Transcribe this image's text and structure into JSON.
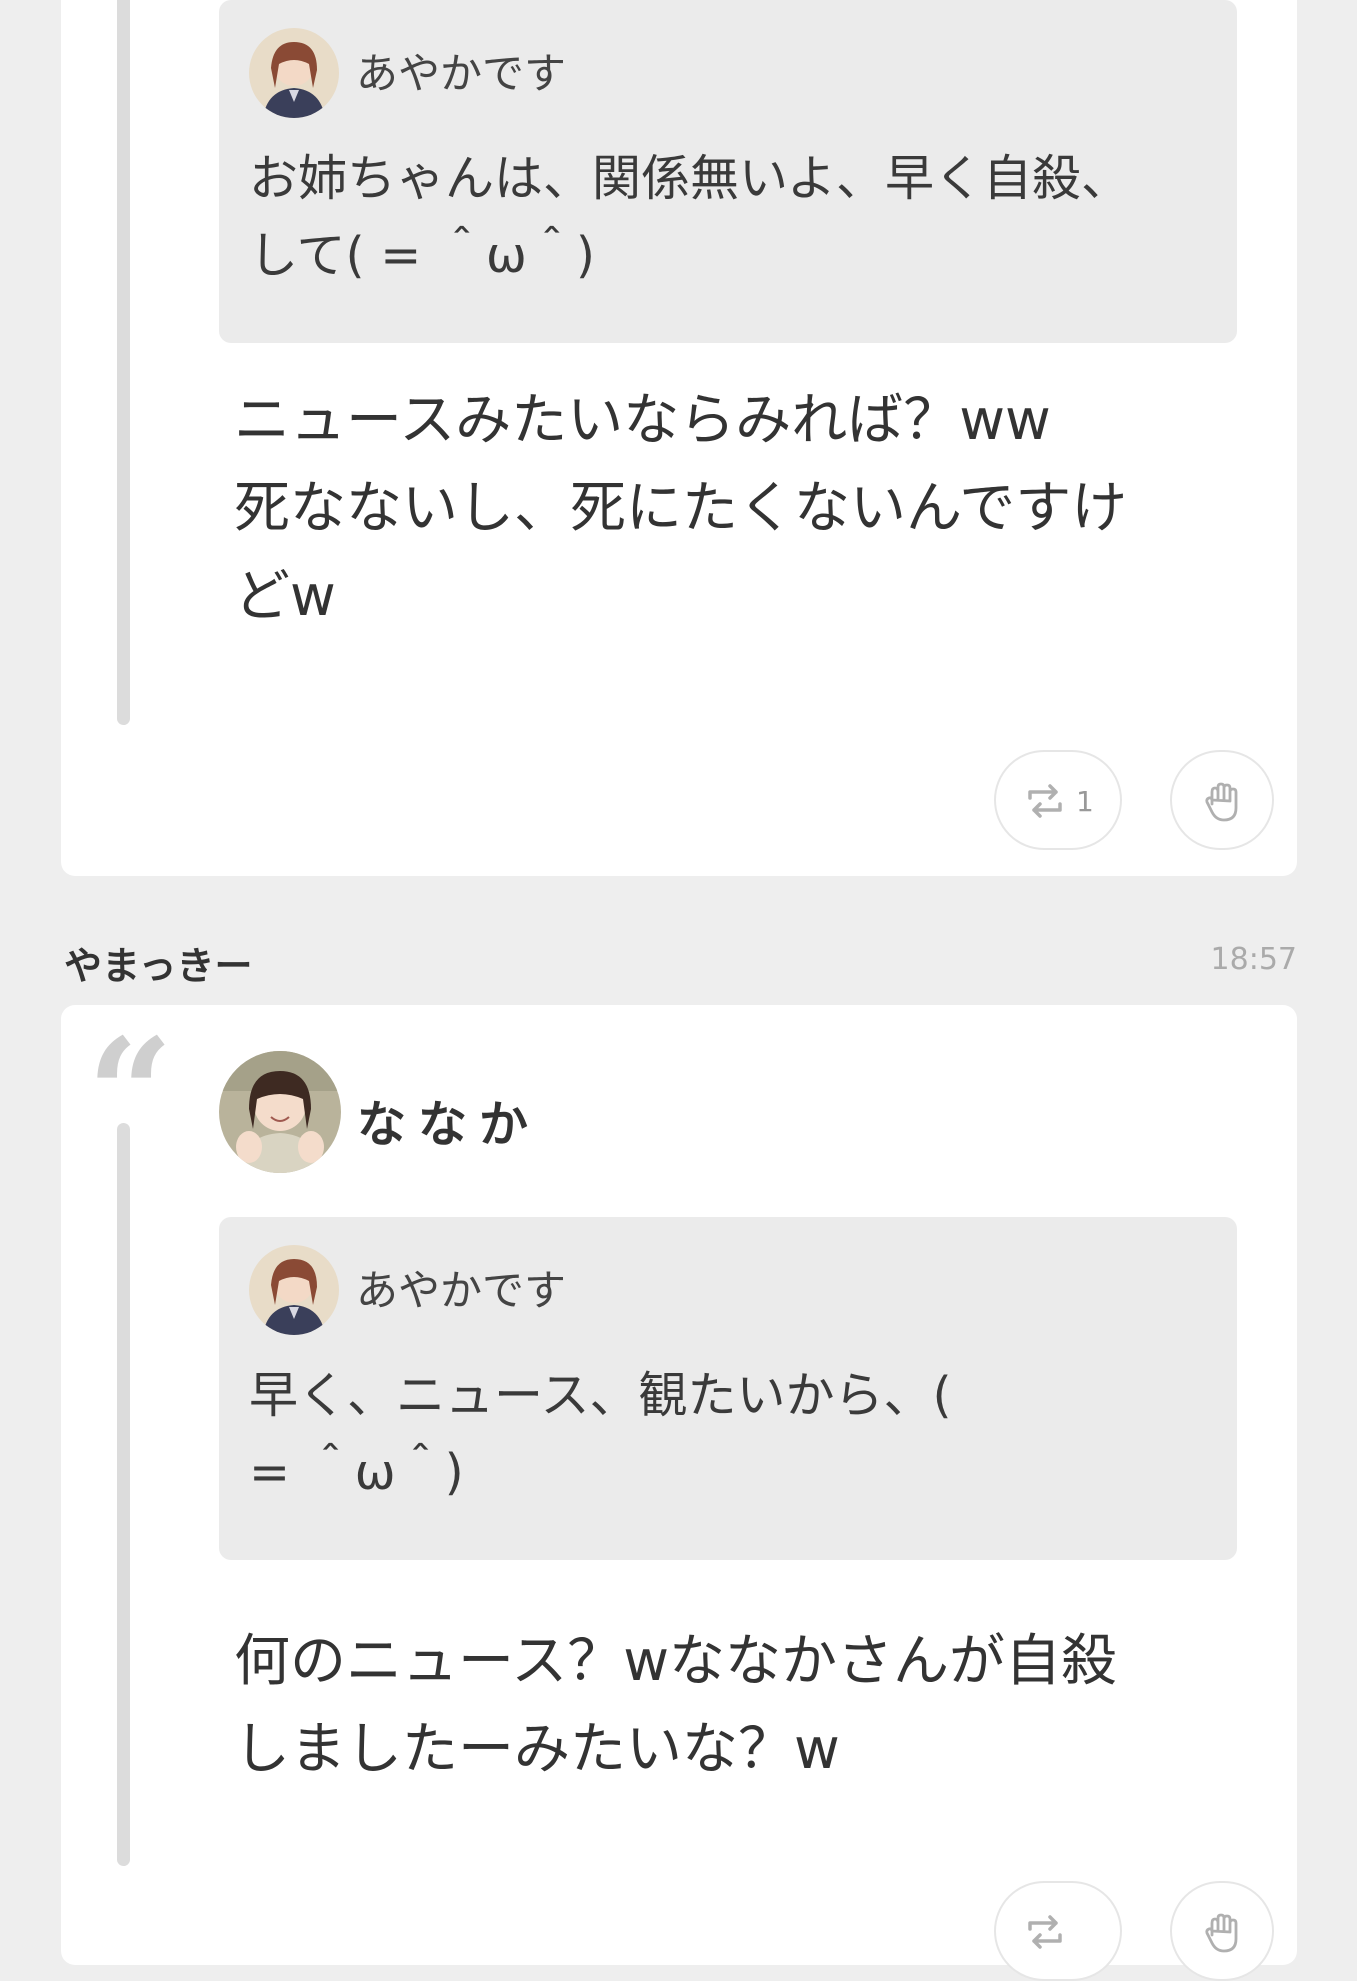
{
  "posts": [
    {
      "quoted": {
        "inner": {
          "name": "あやかです",
          "text": "お姉ちゃんは、関係無いよ、早く自殺、\nして( = ＾ω＾)"
        },
        "text": "ニュースみたいならみれば？ww\n死なないし、死にたくないんですけ\nどw"
      },
      "actions": {
        "repost_count": "1",
        "repost_icon": "repost-icon",
        "clap_icon": "clap-icon"
      }
    },
    {
      "author": "やまっきー",
      "time": "18:57",
      "quoted": {
        "poster_name": "ななか",
        "inner": {
          "name": "あやかです",
          "text": "早く、ニュース、観たいから、(\n= ＾ω＾)"
        },
        "text": "何のニュース？wななかさんが自殺\nしましたーみたいな？w"
      },
      "actions": {
        "repost_icon": "repost-icon",
        "clap_icon": "clap-icon"
      }
    }
  ],
  "quote_mark": "“",
  "colors": {
    "background": "#eeeeee",
    "card": "#ffffff",
    "inner_card": "#ebebeb",
    "quote_bar": "#dcdcdc",
    "text": "#333333",
    "muted": "#aaaaaa"
  }
}
